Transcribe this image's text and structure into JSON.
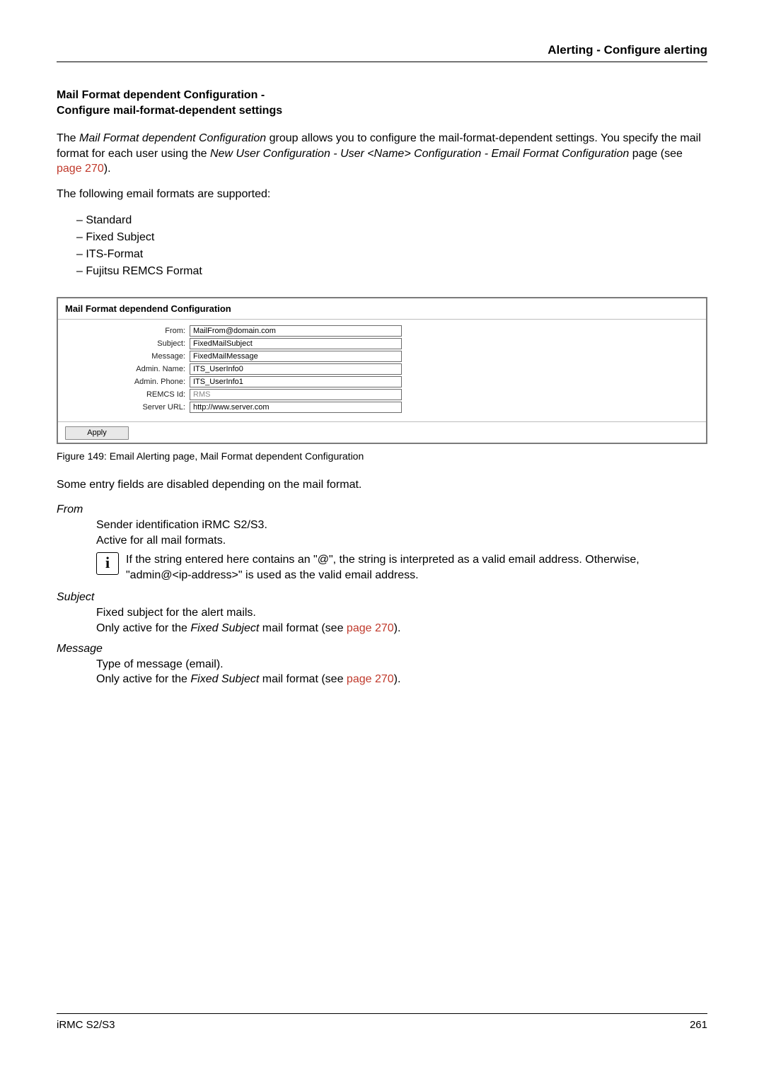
{
  "header": {
    "title": "Alerting - Configure alerting"
  },
  "section": {
    "title_line1": "Mail Format dependent Configuration -",
    "title_line2": "Configure mail-format-dependent settings"
  },
  "intro": {
    "pre": "The ",
    "italic1": "Mail Format dependent Configuration",
    "mid1": " group allows you to configure the mail-format-dependent settings. You specify the mail format for each user using the ",
    "italic2": "New User Configuration",
    "sep1": " - ",
    "italic3": "User <Name> Configuration",
    "sep2": " - ",
    "italic4": "Email Format Configuration",
    "post1": " page (see ",
    "link1": "page 270",
    "post2": ")."
  },
  "supported_line": "The following email formats are supported:",
  "formats": [
    "Standard",
    "Fixed Subject",
    "ITS-Format",
    "Fujitsu REMCS Format"
  ],
  "figure": {
    "panel_title": "Mail Format dependend Configuration",
    "rows": [
      {
        "label": "From:",
        "value": "MailFrom@domain.com",
        "ro": false
      },
      {
        "label": "Subject:",
        "value": "FixedMailSubject",
        "ro": false
      },
      {
        "label": "Message:",
        "value": "FixedMailMessage",
        "ro": false
      },
      {
        "label": "Admin. Name:",
        "value": "ITS_UserInfo0",
        "ro": false
      },
      {
        "label": "Admin. Phone:",
        "value": "ITS_UserInfo1",
        "ro": false
      },
      {
        "label": "REMCS Id:",
        "value": "RMS",
        "ro": true
      },
      {
        "label": "Server URL:",
        "value": "http://www.server.com",
        "ro": false
      }
    ],
    "apply": "Apply",
    "caption": "Figure 149: Email Alerting page, Mail Format dependent Configuration"
  },
  "after_fig": "Some entry fields are disabled depending on the mail format.",
  "defs": {
    "from": {
      "term": "From",
      "body1": "Sender identification iRMC S2/S3.",
      "body2": "Active for all mail formats.",
      "info": "If the string entered here contains an \"@\", the string is interpreted as a valid email address. Otherwise, \"admin@<ip-address>\" is used as the valid email address."
    },
    "subject": {
      "term": "Subject",
      "body1": "Fixed subject for the alert mails.",
      "body2_pre": "Only active for the ",
      "body2_italic": "Fixed Subject",
      "body2_mid": " mail format (see ",
      "body2_link": "page 270",
      "body2_post": ")."
    },
    "message": {
      "term": "Message",
      "body1": "Type of message (email).",
      "body2_pre": "Only active for the ",
      "body2_italic": "Fixed Subject",
      "body2_mid": " mail format (see ",
      "body2_link": "page 270",
      "body2_post": ")."
    }
  },
  "footer": {
    "left": "iRMC S2/S3",
    "right": "261"
  }
}
